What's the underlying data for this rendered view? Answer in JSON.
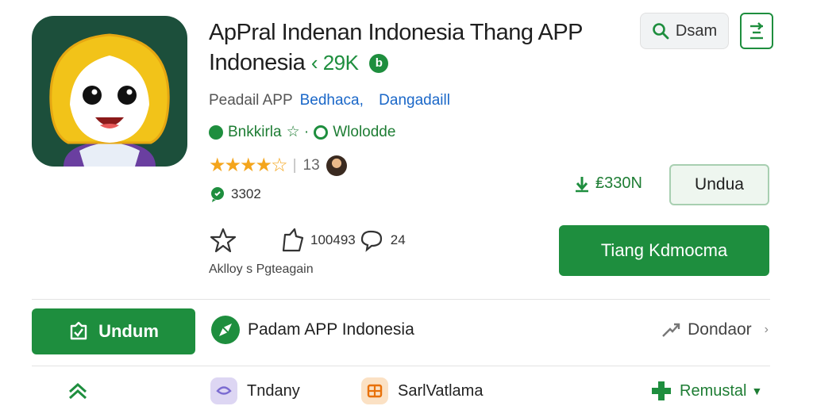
{
  "header": {
    "title_line1": "ApPral Indenan Indonesia Thang APP",
    "title_line2": "Indonesia",
    "version": "‹ 29K",
    "badge_glyph": "b"
  },
  "developer": {
    "label": "Peadail APP",
    "link1": "Bedhaca,",
    "link2": "Dangadaill"
  },
  "tags": {
    "tag1": "Bnkkirla",
    "separator": "☆ ·",
    "tag2": "Wlolodde"
  },
  "rating": {
    "stars": "★★★★☆",
    "count": "13",
    "reviews": "3302"
  },
  "actions": {
    "bookmark_count": "100493",
    "comment_count": "24",
    "caption": "Aklloy s Pgteagain"
  },
  "top_buttons": {
    "search_label": "Dsam"
  },
  "download": {
    "size": "₤330N",
    "secondary_label": "Undua",
    "primary_label": "Tiang Kdmocma"
  },
  "row2": {
    "button_label": "Undum",
    "publisher_name": "Padam APP Indonesia",
    "link_label": "Dondaor"
  },
  "bottom": {
    "item1_label": "Tndany",
    "item2_label": "SarlVatlama",
    "item3_label": "Remustal"
  },
  "colors": {
    "accent": "#1e8e3e",
    "link": "#1a67c8",
    "star": "#f4a51c",
    "icon_bg": "#1c4f3b"
  }
}
